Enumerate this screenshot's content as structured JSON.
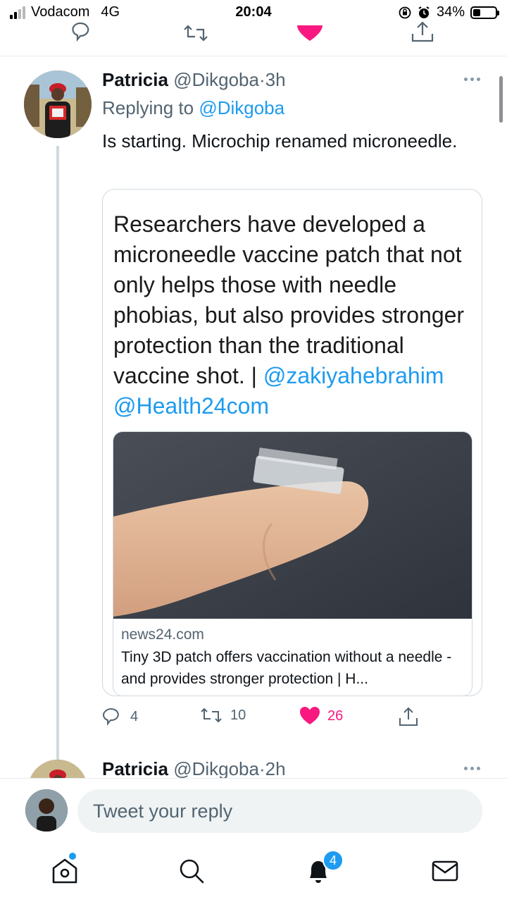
{
  "status_bar": {
    "carrier": "Vodacom",
    "network": "4G",
    "time": "20:04",
    "battery": "34%",
    "battery_fraction": 0.34
  },
  "tweet": {
    "author_name": "Patricia",
    "author_handle": "@Dikgoba",
    "separator": "·",
    "time_ago": "3h",
    "reply_prefix": "Replying to",
    "reply_handle": "@Dikgoba",
    "text": "Is starting. Microchip renamed microneedle.",
    "quote": {
      "text": "Researchers have developed a microneedle vaccine patch that not only helps those with needle phobias, but also provides stronger protection than the traditional vaccine shot. |",
      "mention_1": "@zakiyahebrahim",
      "mention_2": "@Health24com",
      "link_domain": "news24.com",
      "link_title": "Tiny 3D patch offers vaccination without a needle - and provides stronger protection | H..."
    },
    "actions": {
      "replies": "4",
      "retweets": "10",
      "likes": "26"
    }
  },
  "next_tweet": {
    "author_name": "Patricia",
    "author_handle": "@Dikgoba",
    "separator": "·",
    "time_ago": "2h"
  },
  "reply_bar": {
    "placeholder": "Tweet your reply"
  },
  "bottom_nav": {
    "notifications_badge": "4"
  },
  "colors": {
    "accent": "#1d9bf0",
    "like": "#f91880",
    "secondary_text": "#536471"
  },
  "icons": [
    "reply-icon",
    "retweet-icon",
    "heart-icon",
    "share-icon",
    "home-icon",
    "search-icon",
    "bell-icon",
    "mail-icon"
  ]
}
